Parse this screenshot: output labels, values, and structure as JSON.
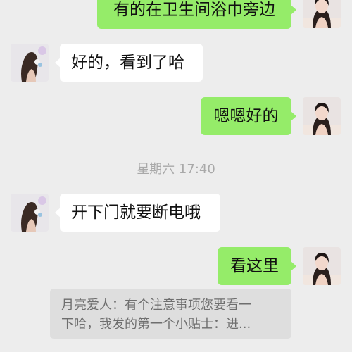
{
  "chat": {
    "messages": [
      {
        "side": "out",
        "text": "有的在卫生间浴巾旁边"
      },
      {
        "side": "in",
        "text": "好的，看到了哈"
      },
      {
        "side": "out",
        "text": "嗯嗯好的"
      },
      {
        "side": "in",
        "text": "开下门就要断电哦"
      },
      {
        "side": "out",
        "text": "看这里"
      }
    ],
    "timestamp": "星期六 17:40",
    "quoted_reply": {
      "line1": "月亮爱人：有个注意事项您要看一",
      "line2": "下哈，我发的第一个小贴士：进..."
    }
  },
  "colors": {
    "background": "#ededed",
    "outgoing_bubble": "#95ec69",
    "incoming_bubble": "#ffffff",
    "quote_background": "#dedede"
  },
  "icons": {
    "self_avatar": "self-avatar-photo",
    "contact_avatar": "contact-avatar-photo"
  }
}
